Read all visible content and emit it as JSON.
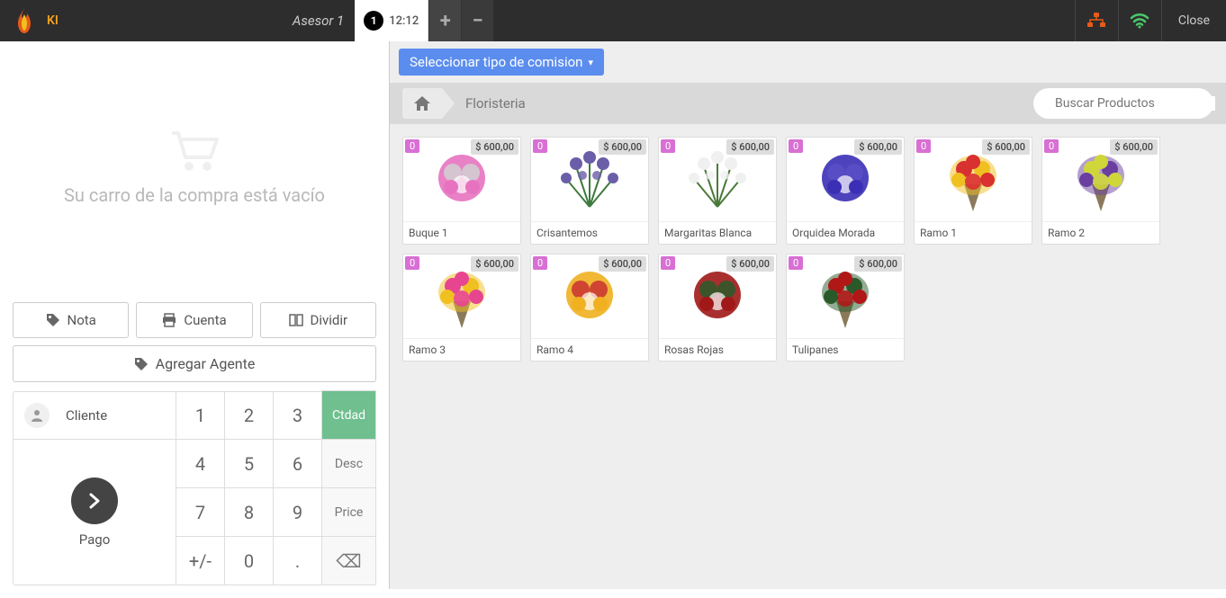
{
  "header": {
    "logo_text": "KI",
    "asesor": "Asesor 1",
    "tab_number": "1",
    "tab_time": "12:12",
    "close": "Close"
  },
  "cart": {
    "empty_text": "Su carro de la compra está vacío"
  },
  "actions": {
    "nota": "Nota",
    "cuenta": "Cuenta",
    "dividir": "Dividir",
    "agregar_agente": "Agregar Agente"
  },
  "client": {
    "label": "Cliente",
    "pago": "Pago"
  },
  "keypad": {
    "1": "1",
    "2": "2",
    "3": "3",
    "4": "4",
    "5": "5",
    "6": "6",
    "7": "7",
    "8": "8",
    "9": "9",
    "pm": "+/-",
    "0": "0",
    "dot": ".",
    "qty": "Ctdad",
    "desc": "Desc",
    "price": "Price",
    "del": "⌫"
  },
  "commission": {
    "label": "Seleccionar tipo de comision"
  },
  "breadcrumb": {
    "category": "Floristeria"
  },
  "search": {
    "placeholder": "Buscar Productos"
  },
  "products": [
    {
      "qty": "0",
      "price": "$ 600,00",
      "name": "Buque 1",
      "color1": "#e773c0",
      "color2": "#d1d1d1",
      "shape": "round"
    },
    {
      "qty": "0",
      "price": "$ 600,00",
      "name": "Crisantemos",
      "color1": "#6b5ea8",
      "color2": "#3e7a3e",
      "shape": "spray"
    },
    {
      "qty": "0",
      "price": "$ 600,00",
      "name": "Margaritas Blanca",
      "color1": "#f0f0f0",
      "color2": "#4a7a3a",
      "shape": "spray"
    },
    {
      "qty": "0",
      "price": "$ 600,00",
      "name": "Orquidea Morada",
      "color1": "#3a2fb5",
      "color2": "#5a4fc5",
      "shape": "round"
    },
    {
      "qty": "0",
      "price": "$ 600,00",
      "name": "Ramo 1",
      "color1": "#d93030",
      "color2": "#f0c020",
      "shape": "bouquet"
    },
    {
      "qty": "0",
      "price": "$ 600,00",
      "name": "Ramo 2",
      "color1": "#cfd63a",
      "color2": "#6b3fa0",
      "shape": "bouquet"
    },
    {
      "qty": "0",
      "price": "$ 600,00",
      "name": "Ramo 3",
      "color1": "#e74590",
      "color2": "#f0c020",
      "shape": "bouquet"
    },
    {
      "qty": "0",
      "price": "$ 600,00",
      "name": "Ramo 4",
      "color1": "#f0b020",
      "color2": "#c93030",
      "shape": "round"
    },
    {
      "qty": "0",
      "price": "$ 600,00",
      "name": "Rosas Rojas",
      "color1": "#a01818",
      "color2": "#2a5a2a",
      "shape": "round"
    },
    {
      "qty": "0",
      "price": "$ 600,00",
      "name": "Tulipanes",
      "color1": "#b01818",
      "color2": "#2a5a2a",
      "shape": "bouquet"
    }
  ]
}
